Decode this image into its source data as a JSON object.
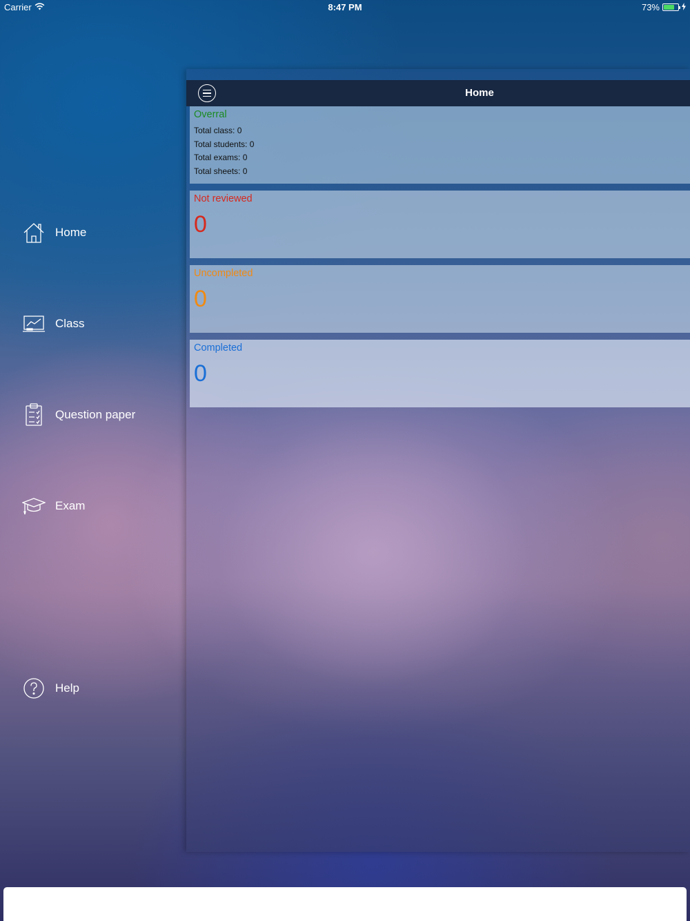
{
  "status_bar": {
    "carrier": "Carrier",
    "time": "8:47 PM",
    "battery": "73%",
    "battery_level": 0.73
  },
  "sidebar": {
    "items": [
      {
        "label": "Home",
        "icon": "home-icon"
      },
      {
        "label": "Class",
        "icon": "chart-board-icon"
      },
      {
        "label": "Question paper",
        "icon": "clipboard-icon"
      },
      {
        "label": "Exam",
        "icon": "graduation-cap-icon"
      },
      {
        "label": "Help",
        "icon": "help-icon"
      }
    ]
  },
  "navbar": {
    "title": "Home",
    "menu_icon": "menu-icon"
  },
  "overall": {
    "title": "Overral",
    "stats": [
      {
        "label": "Total class:",
        "value": "0"
      },
      {
        "label": "Total students:",
        "value": "0"
      },
      {
        "label": "Total exams:",
        "value": "0"
      },
      {
        "label": "Total sheets:",
        "value": "0"
      }
    ]
  },
  "cards": {
    "not_reviewed": {
      "title": "Not reviewed",
      "value": "0"
    },
    "uncompleted": {
      "title": "Uncompleted",
      "value": "0"
    },
    "completed": {
      "title": "Completed",
      "value": "0"
    }
  },
  "colors": {
    "overall": "#1b8a22",
    "not_reviewed": "#d62a1e",
    "uncompleted": "#f08a12",
    "completed": "#1a6fd6",
    "navbar": "#182842",
    "battery": "#4cd964"
  }
}
